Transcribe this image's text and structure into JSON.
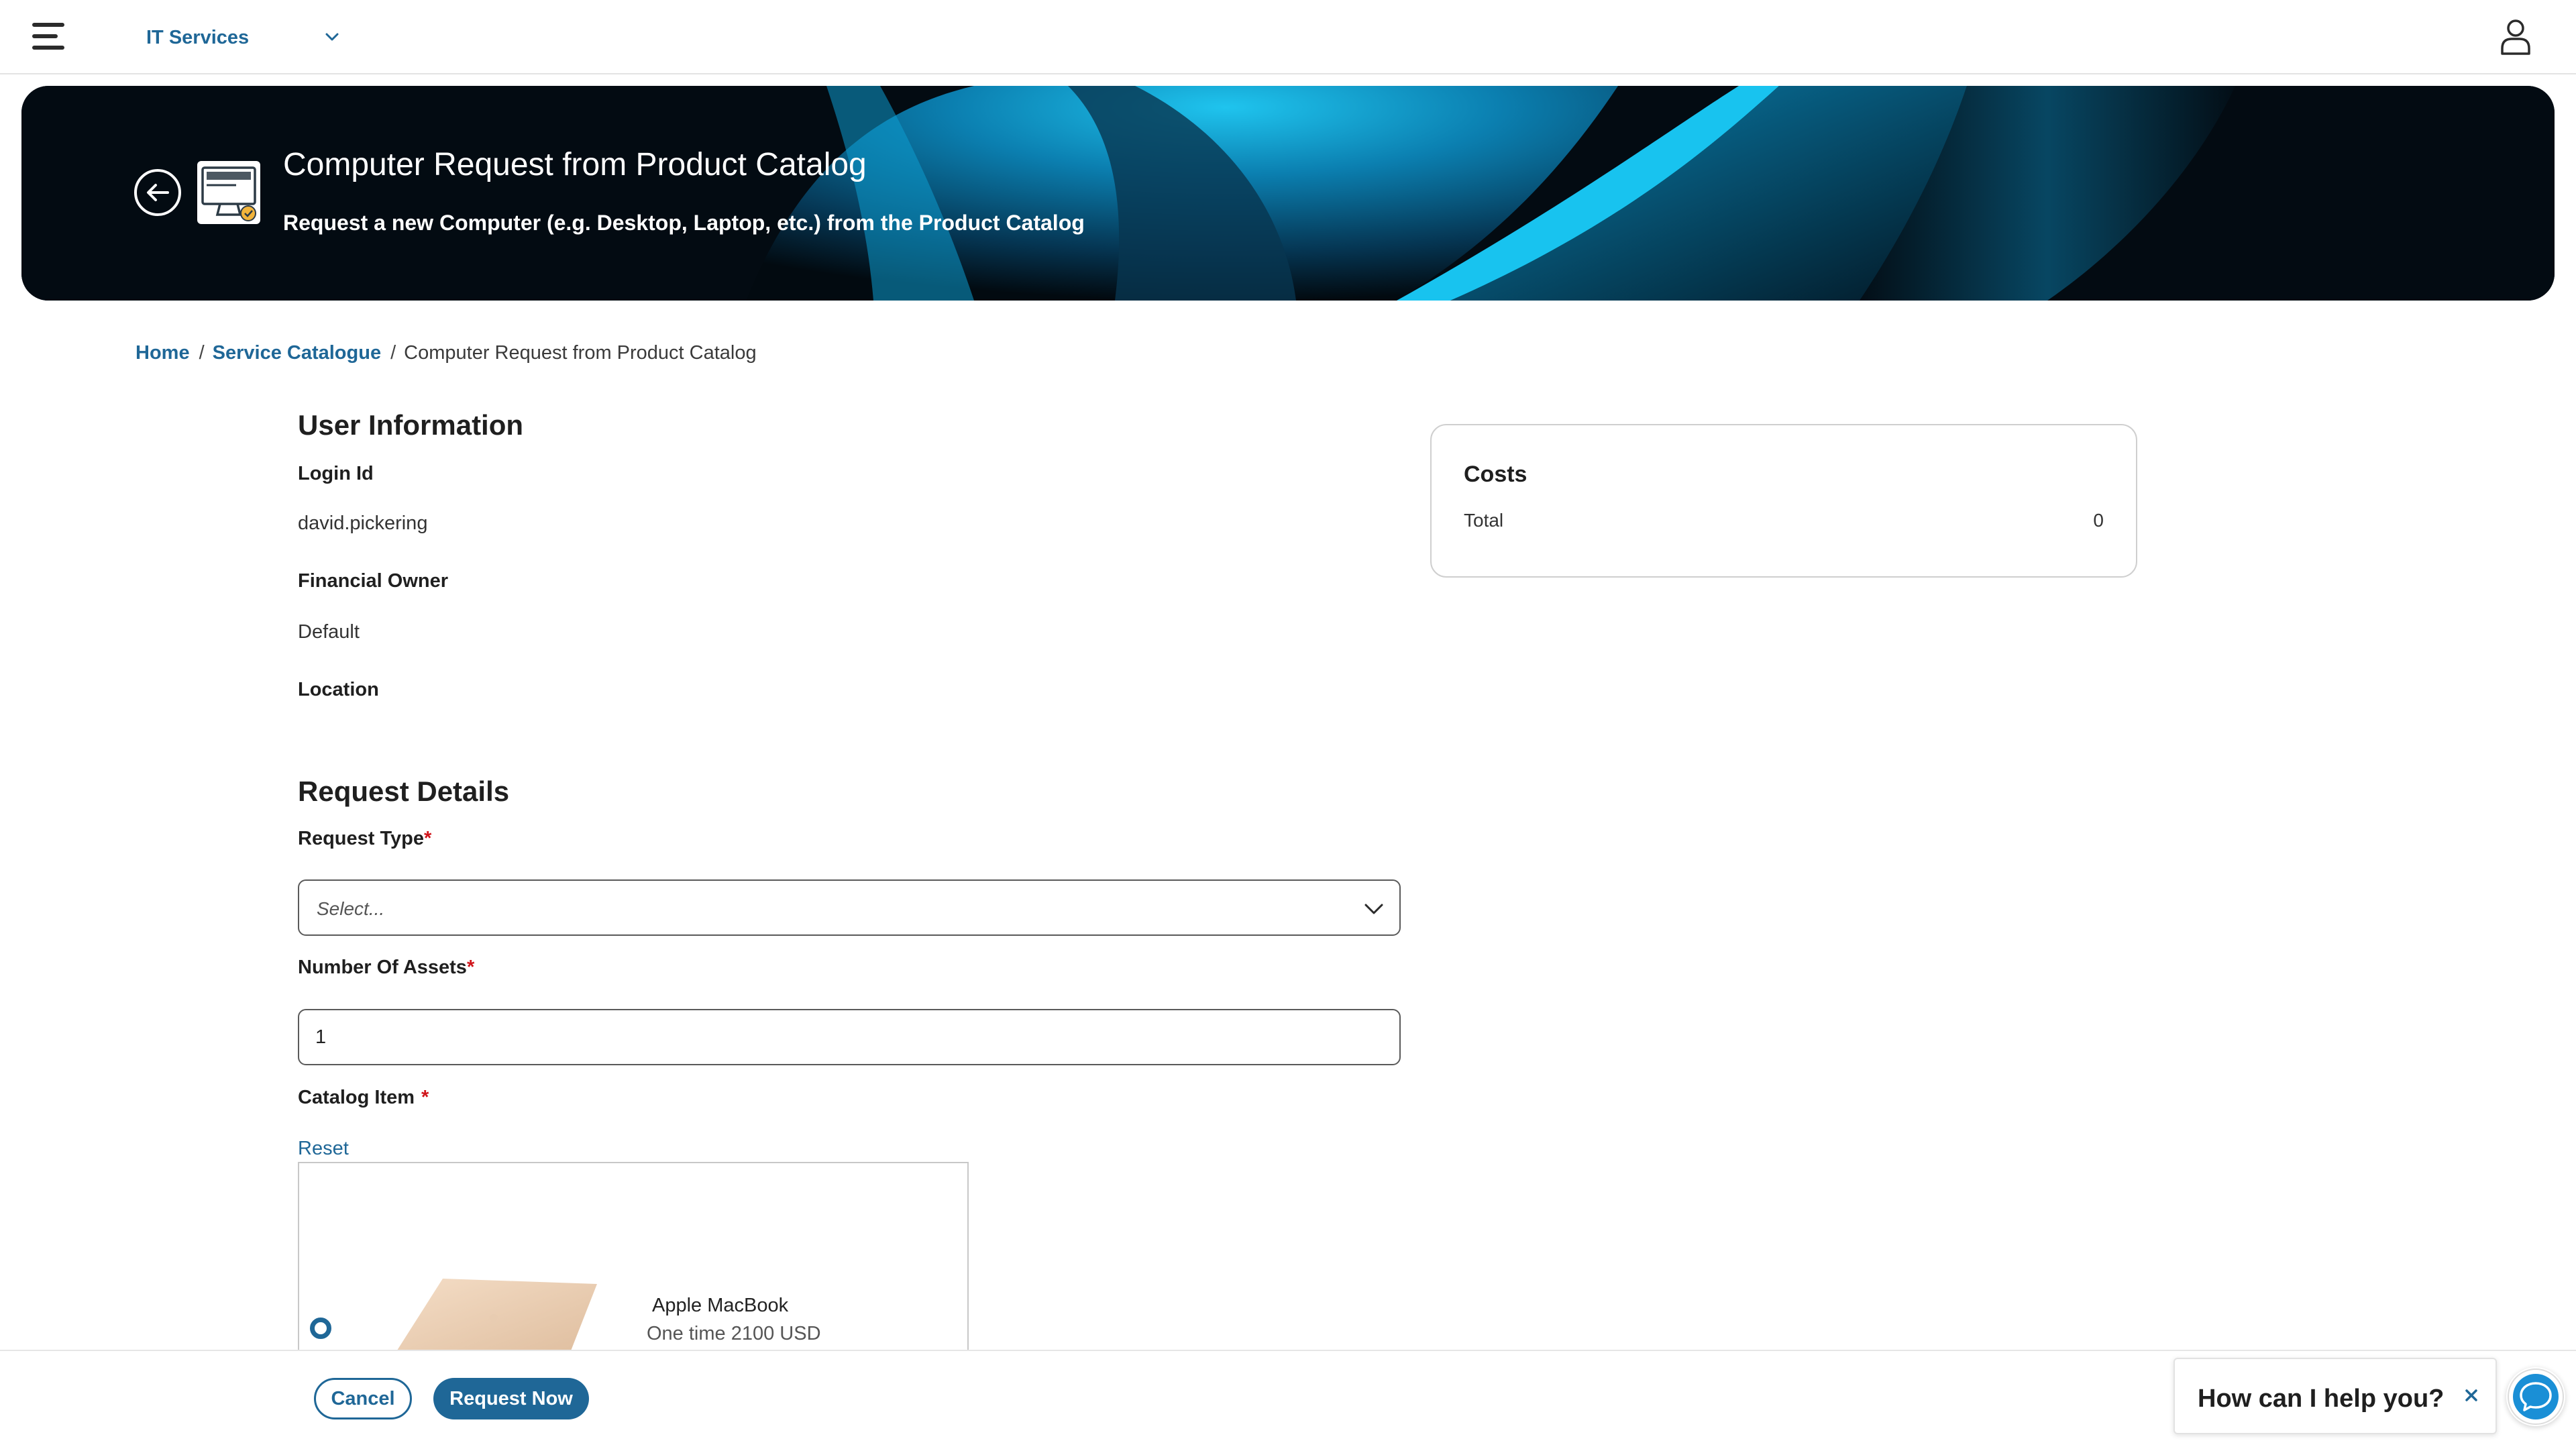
{
  "topbar": {
    "app_name": "IT Services"
  },
  "hero": {
    "title": "Computer Request from Product Catalog",
    "subtitle": "Request a new Computer (e.g. Desktop, Laptop, etc.) from the Product Catalog"
  },
  "breadcrumb": {
    "home": "Home",
    "service_catalogue": "Service Catalogue",
    "current": "Computer Request from Product Catalog",
    "separator": "/"
  },
  "user_info": {
    "title": "User Information",
    "login_id_label": "Login Id",
    "login_id_value": "david.pickering",
    "financial_owner_label": "Financial Owner",
    "financial_owner_value": "Default",
    "location_label": "Location"
  },
  "request_details": {
    "title": "Request Details",
    "request_type_label": "Request Type",
    "request_type_placeholder": "Select...",
    "number_of_assets_label": "Number Of Assets",
    "number_of_assets_value": "1",
    "catalog_item_label": "Catalog Item",
    "required_marker": "*",
    "reset_label": "Reset",
    "catalog_items": [
      {
        "name": "Apple MacBook",
        "price": "One time 2100 USD",
        "selected": true
      }
    ]
  },
  "costs": {
    "title": "Costs",
    "total_label": "Total",
    "total_value": "0"
  },
  "footer": {
    "cancel_label": "Cancel",
    "request_label": "Request Now"
  },
  "chat": {
    "prompt": "How can I help you?"
  },
  "colors": {
    "accent": "#1f6797",
    "required": "#d0141a",
    "hero_bg": "#030b12",
    "hero_glow": "#0aa9d8"
  },
  "icons": {
    "menu": "hamburger-menu-icon",
    "app_switch": "chevron-down-icon",
    "user": "user-profile-icon",
    "back": "arrow-left-circle-icon",
    "hero": "computer-monitor-icon",
    "select": "chevron-down-icon",
    "close": "close-icon",
    "chat": "chat-bubble-icon"
  }
}
